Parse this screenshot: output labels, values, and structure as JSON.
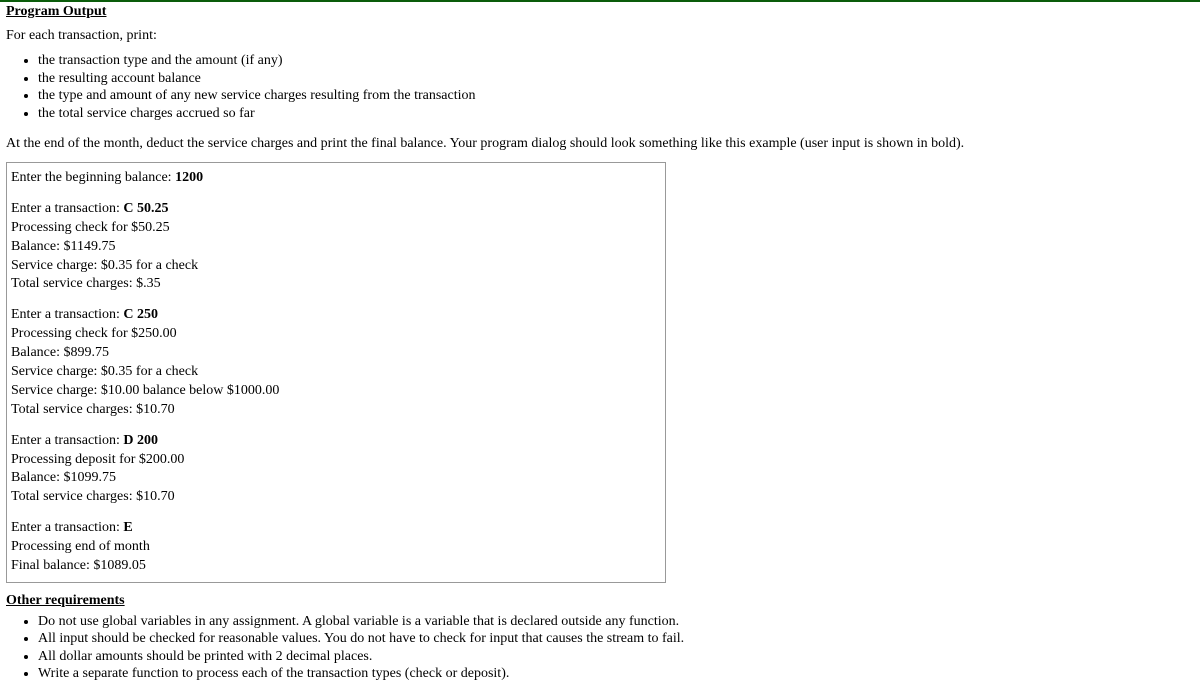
{
  "heading1": "Program Output",
  "intro": "For each transaction, print:",
  "bullets1": [
    "the transaction type and the amount (if any)",
    "the resulting account balance",
    "the type and amount of any new service charges resulting from the transaction",
    "the total service charges accrued so far"
  ],
  "para2": "At the end of the month, deduct the service charges and print the final balance. Your program dialog should look something like this example (user input is shown in bold).",
  "sample": [
    [
      {
        "prefix": "Enter the beginning balance: ",
        "input": "1200"
      }
    ],
    [
      {
        "prefix": "Enter a transaction: ",
        "input": "C 50.25"
      },
      {
        "prefix": "Processing check for $50.25"
      },
      {
        "prefix": "Balance: $1149.75"
      },
      {
        "prefix": "Service charge: $0.35 for a check"
      },
      {
        "prefix": "Total service charges: $.35"
      }
    ],
    [
      {
        "prefix": "Enter a transaction: ",
        "input": "C 250"
      },
      {
        "prefix": "Processing check for $250.00"
      },
      {
        "prefix": "Balance: $899.75"
      },
      {
        "prefix": "Service charge: $0.35 for a check"
      },
      {
        "prefix": "Service charge: $10.00 balance below $1000.00"
      },
      {
        "prefix": "Total service charges: $10.70"
      }
    ],
    [
      {
        "prefix": "Enter a transaction: ",
        "input": "D 200"
      },
      {
        "prefix": "Processing deposit for $200.00"
      },
      {
        "prefix": "Balance: $1099.75"
      },
      {
        "prefix": "Total service charges: $10.70"
      }
    ],
    [
      {
        "prefix": "Enter a transaction: ",
        "input": "E"
      },
      {
        "prefix": "Processing end of month"
      },
      {
        "prefix": "Final balance: $1089.05"
      }
    ]
  ],
  "heading2": "Other requirements",
  "bullets2": [
    "Do not use global variables in any assignment. A global variable is a variable that is declared outside any function.",
    "All input should be checked for reasonable values. You do not have to check for input that causes the stream to fail.",
    "All dollar amounts should be printed with 2 decimal places.",
    "Write a separate function to process each of the transaction types (check or deposit)."
  ]
}
